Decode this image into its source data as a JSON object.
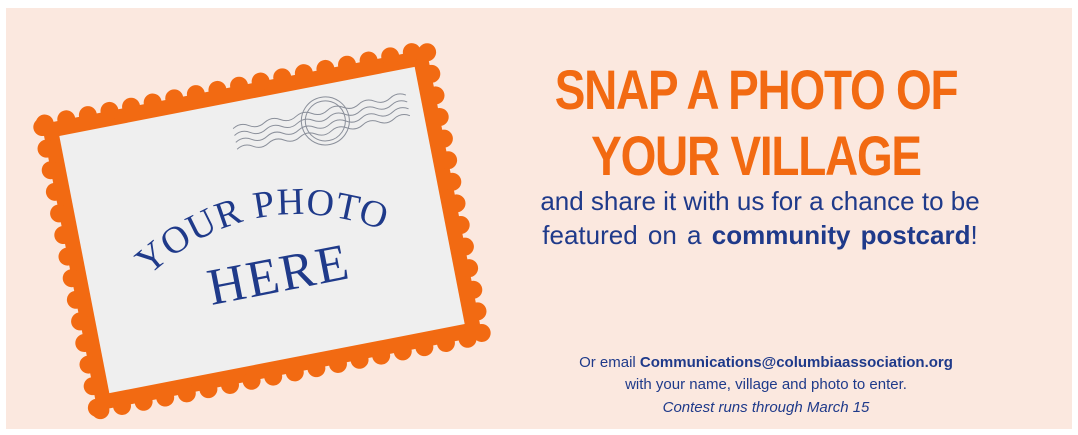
{
  "colors": {
    "background": "#fbe8df",
    "accent_orange": "#f26a12",
    "text_blue": "#1f3a8a",
    "photo_area": "#efefef",
    "postmark_gray": "#8a8f9a"
  },
  "stamp": {
    "photo_text_arc": "YOUR PHOTO",
    "photo_text_main": "HERE",
    "icon": "postmark-icon"
  },
  "headline": {
    "line1": "SNAP A PHOTO OF",
    "line2": "YOUR VILLAGE"
  },
  "subtext": {
    "line1": "and share it with us for a chance to be",
    "line2_prefix": "featured on a ",
    "line2_bold": "community postcard",
    "line2_suffix": "!"
  },
  "footer": {
    "line1_prefix": "Or email ",
    "email": "Communications@columbiaassociation.org",
    "line2": "with your name, village and photo to enter.",
    "line3": "Contest runs through March 15"
  }
}
